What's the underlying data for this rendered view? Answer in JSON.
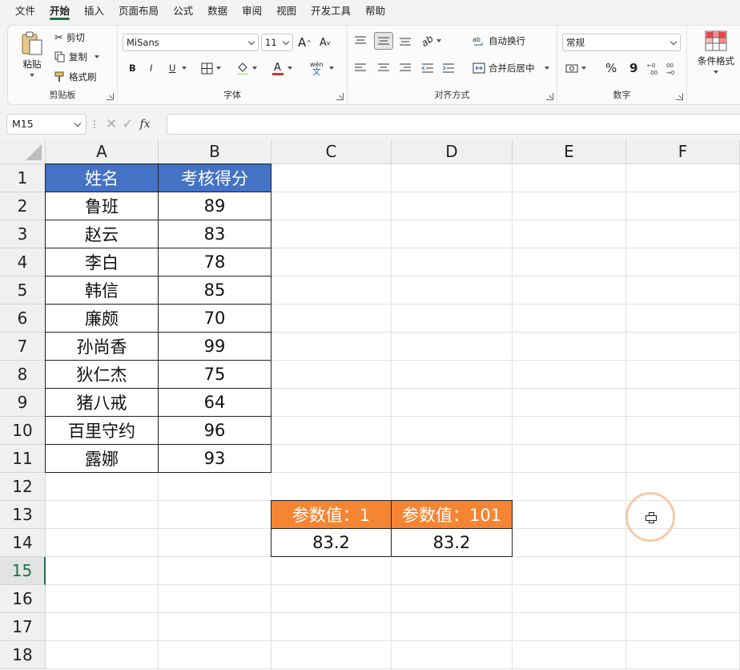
{
  "menu": {
    "items": [
      "文件",
      "开始",
      "插入",
      "页面布局",
      "公式",
      "数据",
      "审阅",
      "视图",
      "开发工具",
      "帮助"
    ],
    "active_index": 1
  },
  "ribbon": {
    "clipboard": {
      "label": "剪贴板",
      "paste": "粘贴",
      "cut": "剪切",
      "copy": "复制",
      "format_painter": "格式刷"
    },
    "font": {
      "label": "字体",
      "font_name": "MiSans",
      "font_size": "11",
      "bold": "B",
      "italic": "I",
      "underline": "U",
      "phonetic": "wén"
    },
    "alignment": {
      "label": "对齐方式",
      "wrap_text": "自动换行",
      "merge_center": "合并后居中"
    },
    "number": {
      "label": "数字",
      "format": "常规",
      "percent": "%",
      "comma": "9"
    },
    "styles": {
      "conditional_format": "条件格式"
    }
  },
  "formula_bar": {
    "name_box": "M15",
    "fx": "fx",
    "formula": ""
  },
  "sheet": {
    "columns": [
      "A",
      "B",
      "C",
      "D",
      "E",
      "F"
    ],
    "rows": [
      "1",
      "2",
      "3",
      "4",
      "5",
      "6",
      "7",
      "8",
      "9",
      "10",
      "11",
      "12",
      "13",
      "14",
      "15",
      "16",
      "17",
      "18"
    ],
    "selected_row": "15",
    "table": {
      "headers": [
        "姓名",
        "考核得分"
      ],
      "rows": [
        [
          "鲁班",
          "89"
        ],
        [
          "赵云",
          "83"
        ],
        [
          "李白",
          "78"
        ],
        [
          "韩信",
          "85"
        ],
        [
          "廉颇",
          "70"
        ],
        [
          "孙尚香",
          "99"
        ],
        [
          "狄仁杰",
          "75"
        ],
        [
          "猪八戒",
          "64"
        ],
        [
          "百里守约",
          "96"
        ],
        [
          "露娜",
          "93"
        ]
      ]
    },
    "param_table": {
      "headers": [
        "参数值：1",
        "参数值：101"
      ],
      "values": [
        "83.2",
        "83.2"
      ]
    }
  },
  "colors": {
    "blue_header": "#4472c4",
    "orange_header": "#f58532",
    "accent_green": "#1e7145"
  }
}
